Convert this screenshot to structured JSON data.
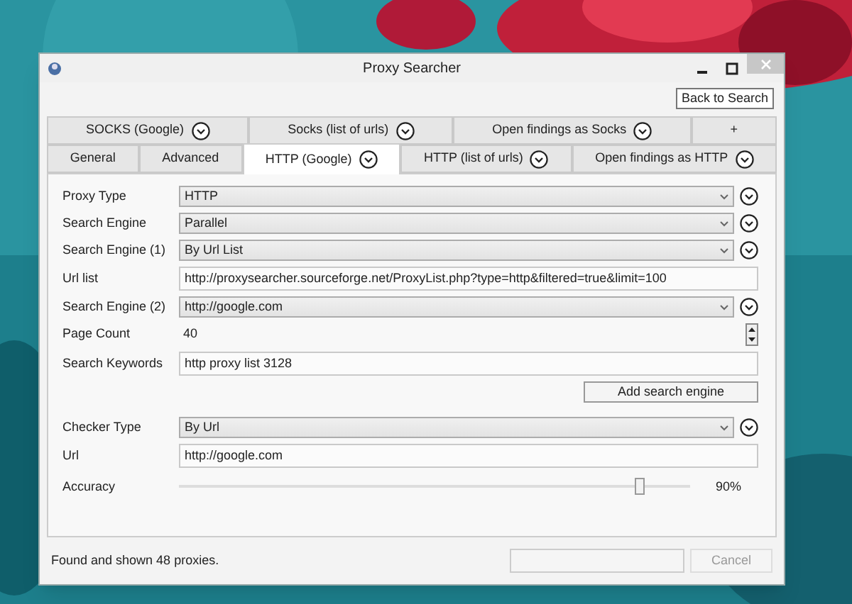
{
  "window": {
    "title": "Proxy Searcher"
  },
  "back_button": "Back to Search",
  "tab_rows": [
    [
      {
        "label": "SOCKS (Google)",
        "menu": true,
        "selected": false
      },
      {
        "label": "Socks (list of urls)",
        "menu": true,
        "selected": false
      },
      {
        "label": "Open findings as Socks",
        "menu": true,
        "selected": false
      },
      {
        "label": "+",
        "menu": false,
        "selected": false
      }
    ],
    [
      {
        "label": "General",
        "menu": false,
        "selected": false
      },
      {
        "label": "Advanced",
        "menu": false,
        "selected": false
      },
      {
        "label": "HTTP (Google)",
        "menu": true,
        "selected": true
      },
      {
        "label": "HTTP (list of urls)",
        "menu": true,
        "selected": false
      },
      {
        "label": "Open findings as HTTP",
        "menu": true,
        "selected": false
      }
    ]
  ],
  "search_section": {
    "rows": [
      {
        "kind": "select",
        "label": "Proxy Type",
        "value": "HTTP"
      },
      {
        "kind": "select",
        "label": "Search Engine",
        "value": "Parallel"
      },
      {
        "kind": "select",
        "label": "Search Engine (1)",
        "value": "By Url List"
      },
      {
        "kind": "text",
        "label": "Url list",
        "value": "http://proxysearcher.sourceforge.net/ProxyList.php?type=http&filtered=true&limit=100"
      },
      {
        "kind": "select",
        "label": "Search Engine (2)",
        "value": "http://google.com"
      },
      {
        "kind": "spin",
        "label": "Page Count",
        "value": "40"
      },
      {
        "kind": "text",
        "label": "Search Keywords",
        "value": "http proxy list 3128"
      }
    ],
    "add_button": "Add search engine"
  },
  "checker_section": {
    "rows": [
      {
        "kind": "select",
        "label": "Checker Type",
        "value": "By Url"
      },
      {
        "kind": "text",
        "label": "Url",
        "value": "http://google.com"
      },
      {
        "kind": "slider",
        "label": "Accuracy",
        "level": 0.9,
        "reading": "90%"
      }
    ]
  },
  "status_bar": {
    "message": "Found and shown 48 proxies.",
    "cancel": {
      "label": "Cancel",
      "disabled": true
    }
  }
}
